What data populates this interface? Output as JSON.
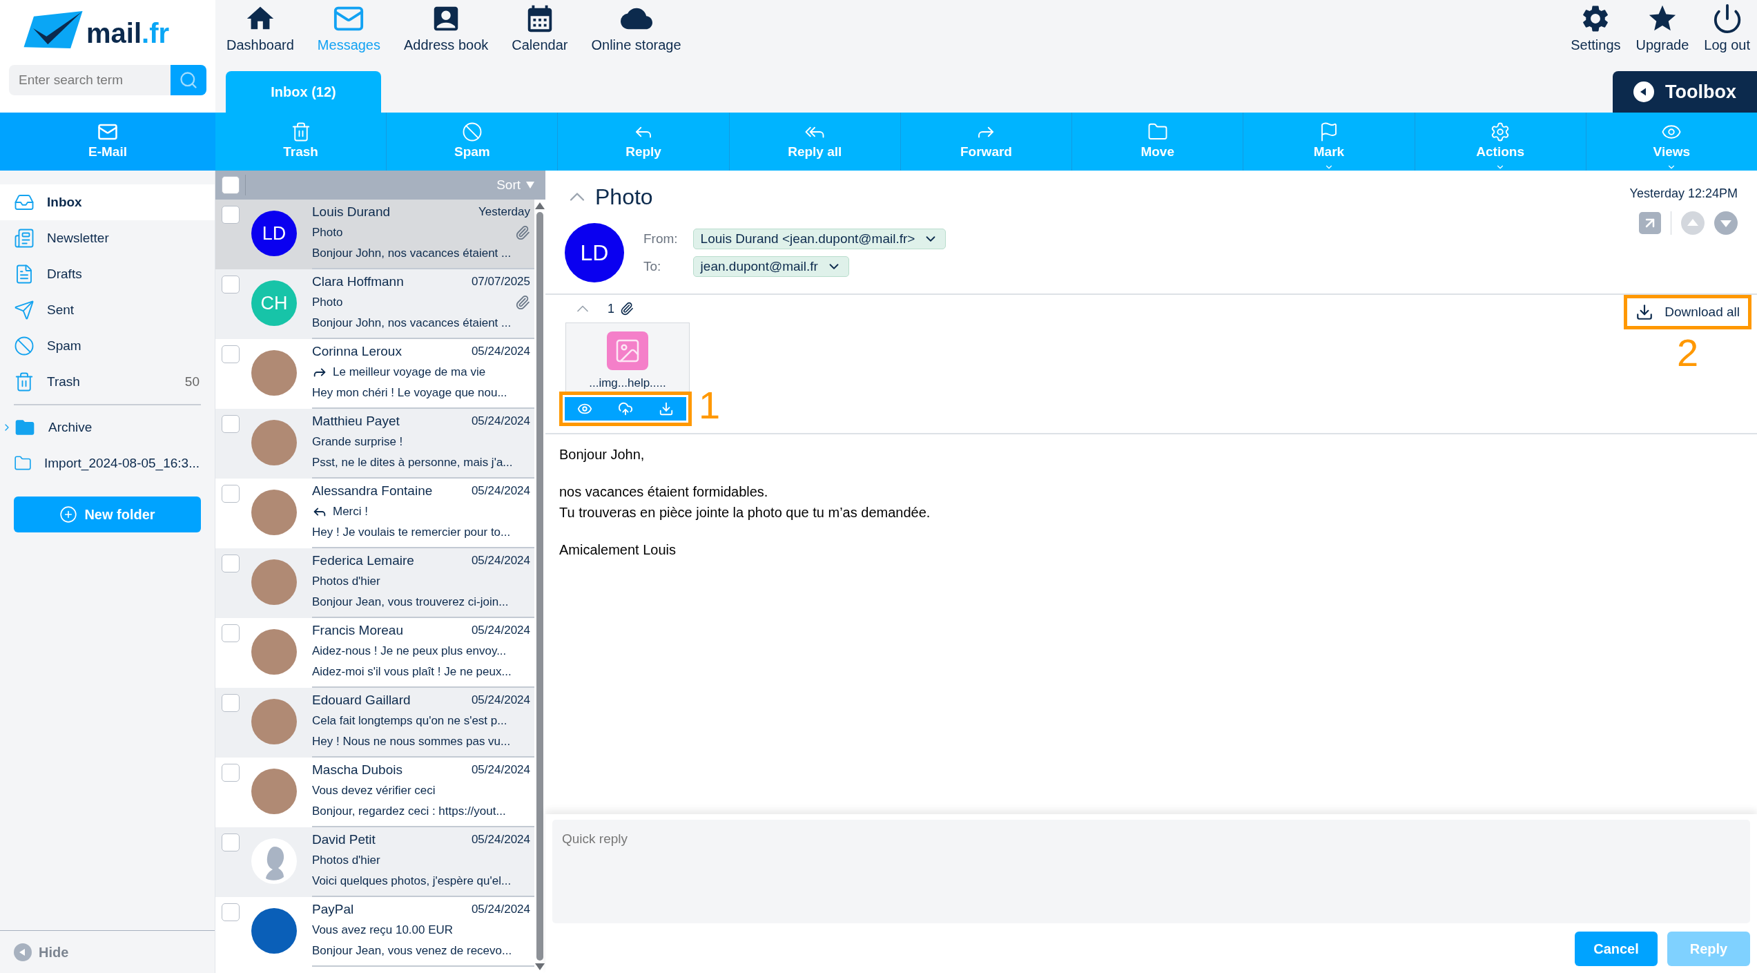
{
  "logo": {
    "name": "mail",
    "suffix": ".fr"
  },
  "search": {
    "placeholder": "Enter search term"
  },
  "nav": [
    {
      "label": "Dashboard",
      "selected": false
    },
    {
      "label": "Messages",
      "selected": true
    },
    {
      "label": "Address book",
      "selected": false
    },
    {
      "label": "Calendar",
      "selected": false
    },
    {
      "label": "Online storage",
      "selected": false
    }
  ],
  "account_nav": [
    {
      "label": "Settings"
    },
    {
      "label": "Upgrade"
    },
    {
      "label": "Log out"
    }
  ],
  "folder_tab": {
    "label": "Inbox (12)"
  },
  "toolbox": {
    "label": "Toolbox"
  },
  "toolbar": {
    "section": "E-Mail",
    "actions": [
      {
        "label": "Trash",
        "dropdown": false
      },
      {
        "label": "Spam",
        "dropdown": false
      },
      {
        "label": "Reply",
        "dropdown": false
      },
      {
        "label": "Reply all",
        "dropdown": false
      },
      {
        "label": "Forward",
        "dropdown": false
      },
      {
        "label": "Move",
        "dropdown": false
      },
      {
        "label": "Mark",
        "dropdown": true
      },
      {
        "label": "Actions",
        "dropdown": true
      },
      {
        "label": "Views",
        "dropdown": true
      }
    ]
  },
  "folders": [
    {
      "label": "Inbox",
      "kind": "system",
      "selected": true
    },
    {
      "label": "Newsletter",
      "kind": "system",
      "selected": false
    },
    {
      "label": "Drafts",
      "kind": "system",
      "selected": false
    },
    {
      "label": "Sent",
      "kind": "system",
      "selected": false
    },
    {
      "label": "Spam",
      "kind": "system",
      "selected": false
    },
    {
      "label": "Trash",
      "kind": "system",
      "selected": false,
      "count": "50"
    },
    {
      "label": "Archive",
      "kind": "custom",
      "selected": false,
      "expanded": false
    },
    {
      "label": "Import_2024-08-05_16:3...",
      "kind": "custom",
      "selected": false
    }
  ],
  "new_folder": {
    "label": "New folder"
  },
  "hide": {
    "label": "Hide"
  },
  "list": {
    "sort": "Sort",
    "all_checked": false,
    "rows": [
      {
        "sender": "Louis Durand",
        "date": "Yesterday",
        "subject": "Photo",
        "preview": "Bonjour John, nos vacances étaient ...",
        "avatar": {
          "kind": "initials",
          "text": "LD",
          "color": "#0a00f0"
        },
        "attachment": true,
        "kind": "plain",
        "selected": true,
        "checked": false
      },
      {
        "sender": "Clara Hoffmann",
        "date": "07/07/2025",
        "subject": "Photo",
        "preview": "Bonjour John, nos vacances étaient ...",
        "avatar": {
          "kind": "initials",
          "text": "CH",
          "color": "#17c4a8"
        },
        "attachment": true,
        "kind": "plain",
        "selected": false,
        "checked": false
      },
      {
        "sender": "Corinna Leroux",
        "date": "05/24/2024",
        "subject": "Le meilleur voyage de ma vie",
        "preview": "Hey mon chéri ! Le voyage que nou...",
        "avatar": {
          "kind": "photo"
        },
        "attachment": false,
        "kind": "forwarded",
        "selected": false,
        "checked": false
      },
      {
        "sender": "Matthieu Payet",
        "date": "05/24/2024",
        "subject": "Grande surprise !",
        "preview": "Psst, ne le dites à personne, mais j'a...",
        "avatar": {
          "kind": "photo"
        },
        "attachment": false,
        "kind": "plain",
        "selected": false,
        "checked": false
      },
      {
        "sender": "Alessandra Fontaine",
        "date": "05/24/2024",
        "subject": "Merci !",
        "preview": "Hey ! Je voulais te remercier pour to...",
        "avatar": {
          "kind": "photo"
        },
        "attachment": false,
        "kind": "replied",
        "selected": false,
        "checked": false
      },
      {
        "sender": "Federica Lemaire",
        "date": "05/24/2024",
        "subject": "Photos d'hier",
        "preview": "Bonjour Jean, vous trouverez ci-join...",
        "avatar": {
          "kind": "photo"
        },
        "attachment": false,
        "kind": "plain",
        "selected": false,
        "checked": false
      },
      {
        "sender": "Francis Moreau",
        "date": "05/24/2024",
        "subject": "Aidez-nous ! Je ne peux plus envoy...",
        "preview": "Aidez-moi s'il vous plaît ! Je ne peux...",
        "avatar": {
          "kind": "photo"
        },
        "attachment": false,
        "kind": "plain",
        "selected": false,
        "checked": false
      },
      {
        "sender": "Edouard Gaillard",
        "date": "05/24/2024",
        "subject": "Cela fait longtemps qu'on ne s'est p...",
        "preview": "Hey ! Nous ne nous sommes pas vu...",
        "avatar": {
          "kind": "photo"
        },
        "attachment": false,
        "kind": "plain",
        "selected": false,
        "checked": false
      },
      {
        "sender": "Mascha Dubois",
        "date": "05/24/2024",
        "subject": "Vous devez vérifier ceci",
        "preview": "Bonjour, regardez ceci : https://yout...",
        "avatar": {
          "kind": "photo"
        },
        "attachment": false,
        "kind": "plain",
        "selected": false,
        "checked": false
      },
      {
        "sender": "David Petit",
        "date": "05/24/2024",
        "subject": "Photos d'hier",
        "preview": "Voici quelques photos, j'espère qu'el...",
        "avatar": {
          "kind": "silhouette"
        },
        "attachment": false,
        "kind": "plain",
        "selected": false,
        "checked": false
      },
      {
        "sender": "PayPal",
        "date": "05/24/2024",
        "subject": "Vous avez reçu 10.00 EUR",
        "preview": "Bonjour Jean, vous venez de recevo...",
        "avatar": {
          "kind": "logo"
        },
        "attachment": false,
        "kind": "plain",
        "selected": false,
        "checked": false
      }
    ]
  },
  "message": {
    "title": "Photo",
    "date": "Yesterday 12:24PM",
    "avatar": {
      "text": "LD",
      "color": "#0a00f0"
    },
    "from": {
      "label": "From:",
      "value": "Louis Durand <jean.dupont@mail.fr>"
    },
    "to": {
      "label": "To:",
      "value": "jean.dupont@mail.fr"
    },
    "attachments": {
      "count": "1",
      "files": [
        {
          "name": "...img...help.....",
          "annotation": "1"
        }
      ],
      "download_all": {
        "label": "Download all",
        "annotation": "2"
      }
    },
    "body": [
      {
        "lines": [
          "Bonjour John,"
        ]
      },
      {
        "lines": [
          "nos vacances étaient formidables.",
          "Tu trouveras en pièce jointe la photo que tu m’as demandée."
        ]
      },
      {
        "lines": [
          "Amicalement Louis"
        ]
      }
    ]
  },
  "quick_reply": {
    "placeholder": "Quick reply",
    "buttons": [
      {
        "label": "Cancel",
        "disabled": false
      },
      {
        "label": "Reply",
        "disabled": true
      }
    ]
  }
}
